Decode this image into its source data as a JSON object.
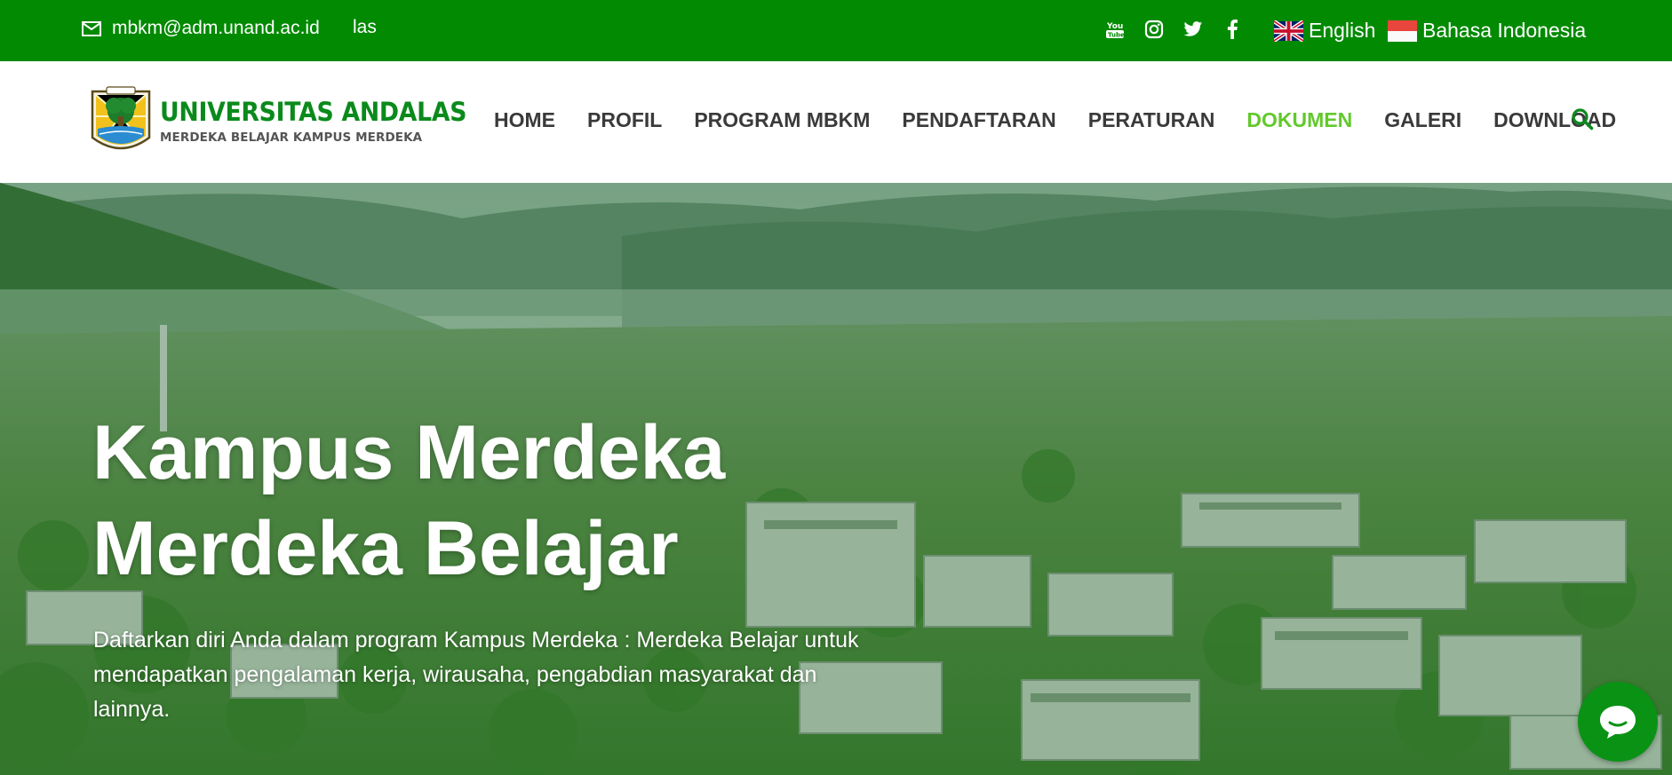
{
  "topbar": {
    "email": "mbkm@adm.unand.ac.id",
    "extra_text": "las",
    "socials": [
      {
        "icon": "youtube-icon"
      },
      {
        "icon": "instagram-icon"
      },
      {
        "icon": "twitter-icon"
      },
      {
        "icon": "facebook-icon"
      }
    ],
    "languages": [
      {
        "label": "English",
        "flag": "uk-flag-icon"
      },
      {
        "label": "Bahasa Indonesia",
        "flag": "indonesia-flag-icon"
      }
    ]
  },
  "brand": {
    "name": "UNIVERSITAS ANDALAS",
    "tagline": "MERDEKA BELAJAR KAMPUS MERDEKA"
  },
  "nav": {
    "items": [
      {
        "label": "HOME"
      },
      {
        "label": "PROFIL"
      },
      {
        "label": "PROGRAM MBKM"
      },
      {
        "label": "PENDAFTARAN"
      },
      {
        "label": "PERATURAN"
      },
      {
        "label": "DOKUMEN",
        "active": true
      },
      {
        "label": "GALERI"
      },
      {
        "label": "DOWNLOAD"
      }
    ],
    "search_icon": "search-icon"
  },
  "hero": {
    "title_line1": "Kampus Merdeka",
    "title_line2": "Merdeka Belajar",
    "description": "Daftarkan diri Anda dalam program Kampus Merdeka : Merdeka Belajar untuk mendapatkan pengalaman kerja, wirausaha, pengabdian masyarakat dan lainnya."
  },
  "chat": {
    "icon": "chat-bubble-icon"
  },
  "colors": {
    "topbar_bg": "#028a02",
    "brand_green": "#0b8a1c",
    "active_nav": "#62c92c",
    "chat_bg": "#0a9215"
  }
}
